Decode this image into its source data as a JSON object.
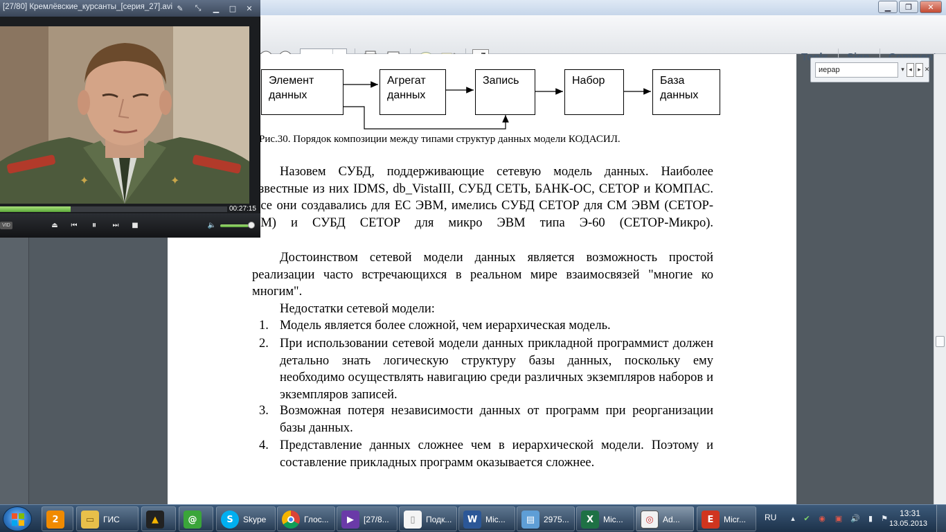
{
  "player": {
    "title": "[27/80] Кремлёвские_курсанты_[серия_27].avi",
    "time": "00:27:15",
    "progress": 0.31,
    "volume": 0.9,
    "badge": "VID"
  },
  "reader": {
    "zoom": "100%",
    "toolbar": {
      "tools": "Tools",
      "sign": "Sign",
      "comment": "Comment"
    },
    "search": {
      "value": "иерар"
    }
  },
  "document": {
    "diagram": {
      "nodes": [
        "Элемент\nданных",
        "Агрегат\nданных",
        "Запись",
        "Набор",
        "База\nданных"
      ]
    },
    "caption": "Рис.30. Порядок композиции между типами структур данных модели КОДАСИЛ.",
    "paragraphs": [
      "Назовем СУБД, поддерживающие сетевую модель данных. Наиболее известные из них IDMS, db_VistaIII, СУБД СЕТЬ, БАНК-ОС, СЕТОР и КОМПАС. Все они создавались для ЕС ЭВМ, имелись СУБД СЕТОР для СМ ЭВМ (СЕТОР-СМ) и СУБД СЕТОР для микро ЭВМ типа Э-60 (СЕТОР-Микро).",
      "Достоинством сетевой модели данных является возможность простой реализации часто встречающихся в реальном мире взаимосвязей \"многие ко многим\".",
      "Недостатки сетевой модели:"
    ],
    "list": [
      {
        "num": "1.",
        "text": "Модель является более сложной, чем иерархическая модель."
      },
      {
        "num": "2.",
        "text": "При использовании сетевой модели данных прикладной программист должен детально знать логическую структуру базы данных, поскольку ему необходимо осуществлять навигацию среди различных экземпляров наборов и экземпляров записей."
      },
      {
        "num": "3.",
        "text": "Возможная потеря независимости данных от программ при реорганизации базы данных."
      },
      {
        "num": "4.",
        "text": "Представление данных  сложнее чем в иерархической модели. Поэтому и составление прикладных программ оказывается сложнее."
      }
    ]
  },
  "taskbar": {
    "items": [
      {
        "label": ""
      },
      {
        "label": "ГИС"
      },
      {
        "label": ""
      },
      {
        "label": ""
      },
      {
        "label": "Skype"
      },
      {
        "label": "Глос..."
      },
      {
        "label": "[27/8..."
      },
      {
        "label": "Подк..."
      },
      {
        "label": "Mic..."
      },
      {
        "label": "2975..."
      },
      {
        "label": "Mic..."
      },
      {
        "label": "Ad..."
      },
      {
        "label": "Micr..."
      }
    ],
    "language": "RU",
    "time": "13:31",
    "date": "13.05.2013"
  }
}
